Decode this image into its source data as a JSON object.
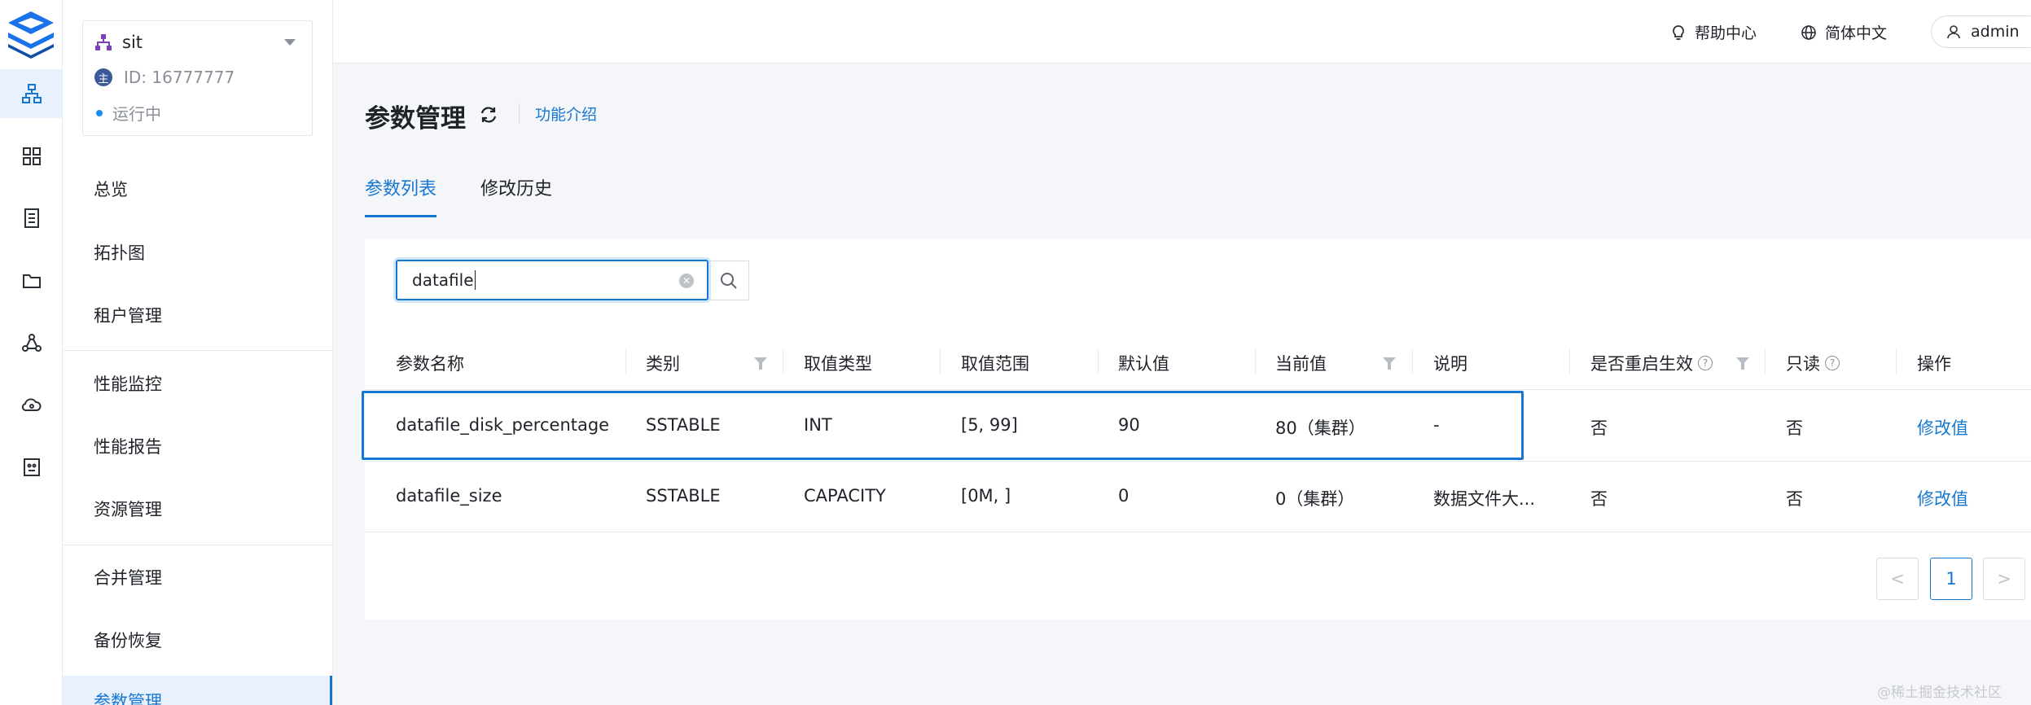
{
  "rail": {
    "items": [
      "logo",
      "cluster-topology-icon",
      "grid-icon",
      "document-list-icon",
      "folder-icon",
      "graph-nodes-icon",
      "cloud-sync-icon",
      "robot-face-icon"
    ],
    "active": "cluster-topology-icon"
  },
  "cluster": {
    "name": "sit",
    "id": "ID: 16777777",
    "badge": "主",
    "status": "运行中"
  },
  "menu": {
    "items": [
      "总览",
      "拓扑图",
      "租户管理",
      "性能监控",
      "性能报告",
      "资源管理",
      "合并管理",
      "备份恢复",
      "参数管理"
    ],
    "active": "参数管理"
  },
  "topbar": {
    "help": "帮助中心",
    "language": "简体中文",
    "user": "admin"
  },
  "page": {
    "title": "参数管理",
    "intro_link": "功能介绍",
    "tabs": [
      "参数列表",
      "修改历史"
    ],
    "active_tab": "参数列表"
  },
  "search": {
    "value": "datafile"
  },
  "table": {
    "columns": [
      "参数名称",
      "类别",
      "取值类型",
      "取值范围",
      "默认值",
      "当前值",
      "说明",
      "是否重启生效",
      "只读",
      "操作"
    ],
    "rows": [
      [
        "datafile_disk_percentage",
        "SSTABLE",
        "INT",
        "[5, 99]",
        "90",
        "80（集群）",
        "-",
        "否",
        "否",
        "修改值"
      ],
      [
        "datafile_size",
        "SSTABLE",
        "CAPACITY",
        "[0M, ]",
        "0",
        "0（集群）",
        "数据文件大...",
        "否",
        "否",
        "修改值"
      ]
    ]
  },
  "pagination": {
    "prev": "<",
    "current": "1",
    "next": ">"
  },
  "watermark": "@稀土掘金技术社区",
  "colors": {
    "primary": "#1677d2",
    "active_bg": "#e8f1fd",
    "page_bg": "#f5f6f9"
  }
}
